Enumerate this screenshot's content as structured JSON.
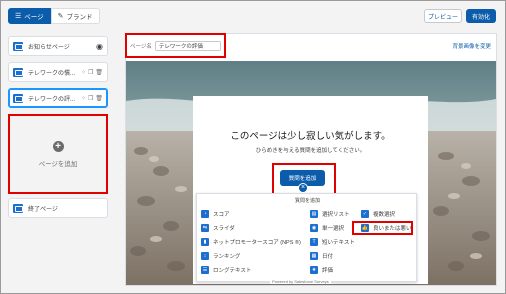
{
  "top_tabs": {
    "pages_label": "ページ",
    "brand_label": "ブランド"
  },
  "toolbar": {
    "preview_label": "プレビュー",
    "activate_label": "有効化"
  },
  "sidebar": {
    "pages": [
      {
        "label": "お知らせページ"
      },
      {
        "label": "テレワークの慣..."
      },
      {
        "label": "テレワークの評..."
      }
    ],
    "add_page_label": "ページを追加",
    "end_page_label": "終了ページ"
  },
  "editor": {
    "page_name_label": "ページ名",
    "page_name_value": "テレワークの評価",
    "background_link": "背景画像を変更",
    "empty_title": "このページは少し寂しい気がします。",
    "empty_subtitle": "ひらめきを与える質問を追加してください。",
    "add_question_label": "質問を追加"
  },
  "question_panel": {
    "title": "質問を追加",
    "items": [
      {
        "label": "スコア",
        "icon": "score-icon"
      },
      {
        "label": "スライダ",
        "icon": "slider-icon"
      },
      {
        "label": "ネットプロモータースコア (NPS ®)",
        "icon": "nps-icon"
      },
      {
        "label": "ランキング",
        "icon": "ranking-icon"
      },
      {
        "label": "ロングテキスト",
        "icon": "long-text-icon"
      },
      {
        "label": "選択リスト",
        "icon": "picklist-icon"
      },
      {
        "label": "単一選択",
        "icon": "single-select-icon"
      },
      {
        "label": "短いテキスト",
        "icon": "short-text-icon"
      },
      {
        "label": "日付",
        "icon": "date-icon"
      },
      {
        "label": "評価",
        "icon": "rating-icon"
      },
      {
        "label": "複数選択",
        "icon": "multi-select-icon"
      },
      {
        "label": "良いまたは悪い",
        "icon": "thumbs-icon"
      }
    ]
  },
  "footer": {
    "powered_by": "Powered by Salesforce Surveys"
  },
  "colors": {
    "brand_blue": "#0b5cab",
    "highlight_red": "#e00000"
  }
}
